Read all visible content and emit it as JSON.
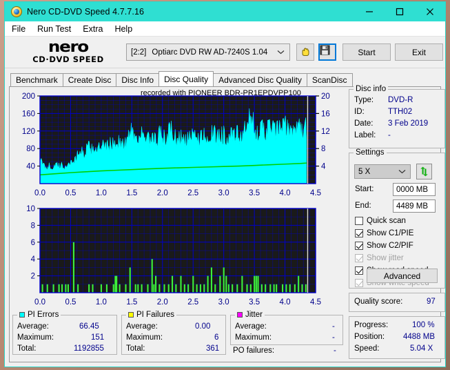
{
  "window": {
    "title": "Nero CD-DVD Speed 4.7.7.16",
    "icon": "nero-disc-icon",
    "titlebar_color": "#2fdfd2",
    "minimize": "minimize-icon",
    "maximize": "maximize-icon",
    "close": "close-icon"
  },
  "menu": {
    "items": [
      "File",
      "Run Test",
      "Extra",
      "Help"
    ]
  },
  "toolbar": {
    "logo_top": "nero",
    "logo_bottom": "CD·DVD  SPEED",
    "drive_id": "[2:2]",
    "drive_name": "Optiarc DVD RW AD-7240S 1.04",
    "hand_icon": "hand-tool-icon",
    "save_icon": "floppy-save-icon",
    "start_label": "Start",
    "exit_label": "Exit"
  },
  "tabs": [
    {
      "label": "Benchmark",
      "active": false
    },
    {
      "label": "Create Disc",
      "active": false
    },
    {
      "label": "Disc Info",
      "active": false
    },
    {
      "label": "Disc Quality",
      "active": true
    },
    {
      "label": "Advanced Disc Quality",
      "active": false
    },
    {
      "label": "ScanDisc",
      "active": false
    }
  ],
  "chart_header": "recorded with PIONEER  BDR-PR1EPDVPP100",
  "disc_info": {
    "legend": "Disc info",
    "rows": [
      {
        "label": "Type:",
        "value": "DVD-R"
      },
      {
        "label": "ID:",
        "value": "TTH02"
      },
      {
        "label": "Date:",
        "value": "3 Feb 2019"
      },
      {
        "label": "Label:",
        "value": "-"
      }
    ]
  },
  "settings": {
    "legend": "Settings",
    "speed": "5 X",
    "refresh_icon": "refresh-arrows-icon",
    "start_label": "Start:",
    "start_value": "0000 MB",
    "end_label": "End:",
    "end_value": "4489 MB",
    "checkboxes": [
      {
        "label": "Quick scan",
        "checked": false,
        "disabled": false
      },
      {
        "label": "Show C1/PIE",
        "checked": true,
        "disabled": false
      },
      {
        "label": "Show C2/PIF",
        "checked": true,
        "disabled": false
      },
      {
        "label": "Show jitter",
        "checked": true,
        "disabled": true
      },
      {
        "label": "Show read speed",
        "checked": true,
        "disabled": false
      },
      {
        "label": "Show write speed",
        "checked": true,
        "disabled": true
      }
    ],
    "advanced_label": "Advanced"
  },
  "quality": {
    "label": "Quality score:",
    "value": "97"
  },
  "progress": {
    "rows": [
      {
        "label": "Progress:",
        "value": "100 %"
      },
      {
        "label": "Position:",
        "value": "4488 MB"
      },
      {
        "label": "Speed:",
        "value": "5.04 X"
      }
    ]
  },
  "stats": {
    "pi_errors": {
      "legend": "PI Errors",
      "color": "#00ffff",
      "rows": [
        {
          "label": "Average:",
          "value": "66.45"
        },
        {
          "label": "Maximum:",
          "value": "151"
        },
        {
          "label": "Total:",
          "value": "1192855"
        }
      ]
    },
    "pi_failures": {
      "legend": "PI Failures",
      "color": "#ffff00",
      "rows": [
        {
          "label": "Average:",
          "value": "0.00"
        },
        {
          "label": "Maximum:",
          "value": "6"
        },
        {
          "label": "Total:",
          "value": "361"
        }
      ]
    },
    "jitter": {
      "legend": "Jitter",
      "color": "#ff00ff",
      "rows": [
        {
          "label": "Average:",
          "value": "-"
        },
        {
          "label": "Maximum:",
          "value": "-"
        }
      ],
      "po_label": "PO failures:",
      "po_value": "-"
    }
  },
  "chart_data": [
    {
      "id": "pie-chart",
      "type": "area",
      "title": "recorded with PIONEER  BDR-PR1EPDVPP100",
      "xlabel": "",
      "ylabel": "PI Errors",
      "xlim": [
        0.0,
        4.5
      ],
      "ylim": [
        0,
        200
      ],
      "y2lim": [
        0,
        20
      ],
      "xticks": [
        0.0,
        0.5,
        1.0,
        1.5,
        2.0,
        2.5,
        3.0,
        3.5,
        4.0,
        4.5
      ],
      "yticks": [
        40,
        80,
        120,
        160,
        200
      ],
      "y2ticks": [
        4,
        8,
        12,
        16,
        20
      ],
      "grid": true,
      "plot_bg": "#1a1a1a",
      "grid_color": "#0000cd",
      "series": [
        {
          "name": "PI Errors",
          "color": "#00ffff",
          "kind": "area",
          "axis": "left",
          "x": [
            0.0,
            0.05,
            0.1,
            0.15,
            0.2,
            0.25,
            0.3,
            0.35,
            0.4,
            0.45,
            0.5,
            0.55,
            0.6,
            0.65,
            0.7,
            0.75,
            0.8,
            0.85,
            0.9,
            0.95,
            1.0,
            1.05,
            1.1,
            1.15,
            1.2,
            1.25,
            1.3,
            1.35,
            1.4,
            1.45,
            1.5,
            1.55,
            1.6,
            1.65,
            1.7,
            1.75,
            1.8,
            1.85,
            1.9,
            1.95,
            2.0,
            2.05,
            2.1,
            2.15,
            2.2,
            2.25,
            2.3,
            2.35,
            2.4,
            2.45,
            2.5,
            2.55,
            2.6,
            2.65,
            2.7,
            2.75,
            2.8,
            2.85,
            2.9,
            2.95,
            3.0,
            3.05,
            3.1,
            3.15,
            3.2,
            3.25,
            3.3,
            3.35,
            3.4,
            3.45,
            3.5,
            3.55,
            3.6,
            3.65,
            3.7,
            3.75,
            3.8,
            3.85,
            3.9,
            3.95,
            4.0,
            4.05,
            4.1,
            4.15,
            4.2,
            4.25,
            4.3,
            4.35
          ],
          "y": [
            55,
            44,
            40,
            42,
            38,
            45,
            41,
            43,
            39,
            46,
            50,
            55,
            62,
            83,
            70,
            80,
            85,
            78,
            88,
            84,
            82,
            90,
            86,
            95,
            92,
            104,
            98,
            90,
            96,
            112,
            140,
            105,
            118,
            122,
            100,
            110,
            96,
            104,
            100,
            118,
            110,
            105,
            122,
            128,
            108,
            104,
            112,
            100,
            108,
            104,
            112,
            118,
            106,
            112,
            120,
            110,
            118,
            115,
            108,
            120,
            118,
            112,
            115,
            110,
            118,
            112,
            118,
            125,
            146,
            152,
            138,
            130,
            124,
            130,
            128,
            136,
            130,
            125,
            132,
            128,
            138,
            128,
            132,
            130,
            128,
            134,
            126,
            132
          ]
        },
        {
          "name": "read speed",
          "color": "#00d000",
          "kind": "line",
          "axis": "right",
          "x": [
            0.0,
            0.25,
            0.5,
            0.75,
            1.0,
            1.25,
            1.5,
            1.75,
            2.0,
            2.25,
            2.5,
            2.75,
            3.0,
            3.25,
            3.5,
            3.75,
            4.0,
            4.25,
            4.35
          ],
          "y": [
            2.0,
            2.25,
            2.5,
            2.7,
            2.9,
            3.05,
            3.2,
            3.35,
            3.5,
            3.6,
            3.7,
            3.8,
            3.9,
            4.0,
            4.15,
            4.3,
            4.45,
            4.6,
            4.7
          ]
        }
      ]
    },
    {
      "id": "pif-chart",
      "type": "bar",
      "title": "",
      "xlabel": "",
      "ylabel": "PI Failures",
      "xlim": [
        0.0,
        4.5
      ],
      "ylim": [
        0,
        10
      ],
      "xticks": [
        0.0,
        0.5,
        1.0,
        1.5,
        2.0,
        2.5,
        3.0,
        3.5,
        4.0,
        4.5
      ],
      "yticks": [
        2,
        4,
        6,
        8,
        10
      ],
      "grid": true,
      "plot_bg": "#1a1a1a",
      "grid_color": "#0000cd",
      "series": [
        {
          "name": "PI Failures",
          "color": "#3cf03c",
          "x": [
            0.04,
            0.12,
            0.22,
            0.31,
            0.36,
            0.42,
            0.46,
            0.55,
            0.62,
            0.8,
            0.86,
            1.0,
            1.09,
            1.2,
            1.23,
            1.25,
            1.3,
            1.4,
            1.47,
            1.56,
            1.6,
            1.66,
            1.76,
            1.83,
            1.86,
            1.89,
            1.95,
            2.03,
            2.1,
            2.16,
            2.22,
            2.3,
            2.36,
            2.42,
            2.5,
            2.56,
            2.62,
            2.68,
            2.74,
            2.8,
            2.86,
            2.94,
            3.0,
            3.04,
            3.08,
            3.14,
            3.22,
            3.3,
            3.38,
            3.44,
            3.5,
            3.53,
            3.56,
            3.62,
            3.68,
            3.76,
            3.82,
            3.86,
            3.96,
            4.02,
            4.08,
            4.16,
            4.22,
            4.28,
            4.34
          ],
          "y": [
            1,
            1,
            1,
            1,
            1,
            1,
            1,
            6,
            1,
            1,
            1,
            1,
            1,
            1,
            2,
            2,
            1,
            1,
            3,
            1,
            1,
            1,
            1,
            4,
            1,
            2,
            1,
            1,
            1,
            2,
            1,
            2,
            1,
            1,
            2,
            1,
            1,
            1,
            2,
            3,
            1,
            2,
            3,
            2,
            1,
            1,
            1,
            2,
            1,
            1,
            2,
            2,
            2,
            1,
            1,
            1,
            1,
            1,
            1,
            1,
            1,
            1,
            2,
            1,
            1
          ]
        }
      ]
    }
  ]
}
